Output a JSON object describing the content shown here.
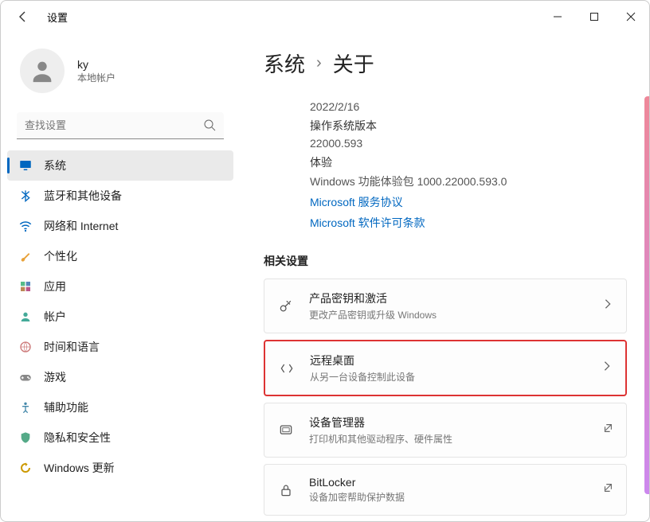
{
  "window": {
    "title": "设置"
  },
  "user": {
    "name": "ky",
    "type": "本地帐户"
  },
  "search": {
    "placeholder": "查找设置"
  },
  "nav": [
    {
      "label": "系统",
      "icon": "display",
      "selected": true
    },
    {
      "label": "蓝牙和其他设备",
      "icon": "bluetooth"
    },
    {
      "label": "网络和 Internet",
      "icon": "wifi"
    },
    {
      "label": "个性化",
      "icon": "brush"
    },
    {
      "label": "应用",
      "icon": "apps"
    },
    {
      "label": "帐户",
      "icon": "person"
    },
    {
      "label": "时间和语言",
      "icon": "globe"
    },
    {
      "label": "游戏",
      "icon": "game"
    },
    {
      "label": "辅助功能",
      "icon": "access"
    },
    {
      "label": "隐私和安全性",
      "icon": "shield"
    },
    {
      "label": "Windows 更新",
      "icon": "update"
    }
  ],
  "breadcrumb": {
    "root": "系统",
    "leaf": "关于"
  },
  "spec": {
    "date": "2022/2/16",
    "os_label": "操作系统版本",
    "os_value": "22000.593",
    "exp_label": "体验",
    "exp_value": "Windows 功能体验包 1000.22000.593.0"
  },
  "links": {
    "service": "Microsoft 服务协议",
    "license": "Microsoft 软件许可条款"
  },
  "related": {
    "heading": "相关设置",
    "items": [
      {
        "title": "产品密钥和激活",
        "sub": "更改产品密钥或升级 Windows",
        "icon": "key",
        "action": "chevron"
      },
      {
        "title": "远程桌面",
        "sub": "从另一台设备控制此设备",
        "icon": "remote",
        "action": "chevron",
        "highlight": true
      },
      {
        "title": "设备管理器",
        "sub": "打印机和其他驱动程序、硬件属性",
        "icon": "devmgr",
        "action": "external"
      },
      {
        "title": "BitLocker",
        "sub": "设备加密帮助保护数据",
        "icon": "lock",
        "action": "external"
      }
    ]
  }
}
